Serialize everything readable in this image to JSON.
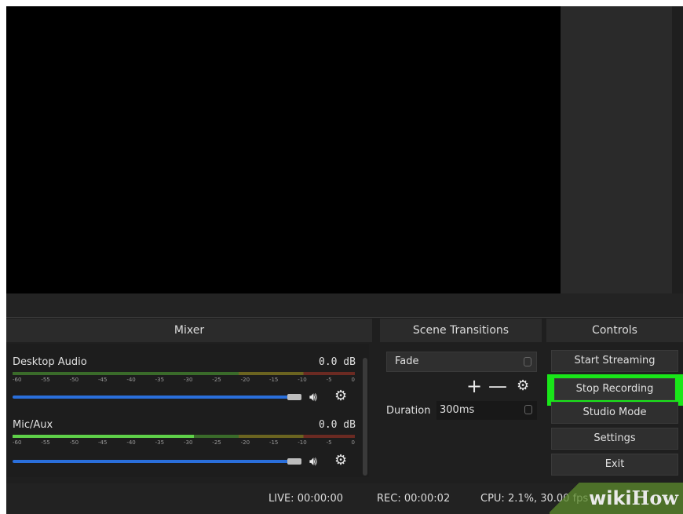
{
  "docks": {
    "mixer_title": "Mixer",
    "transitions_title": "Scene Transitions",
    "controls_title": "Controls"
  },
  "mixer": {
    "tracks": [
      {
        "name": "Desktop Audio",
        "level": "0.0 dB",
        "ticks": [
          "-60",
          "-55",
          "-50",
          "-45",
          "-40",
          "-35",
          "-30",
          "-25",
          "-20",
          "-15",
          "-10",
          "-5",
          "0"
        ],
        "meter_level": 0.0
      },
      {
        "name": "Mic/Aux",
        "level": "0.0 dB",
        "ticks": [
          "-60",
          "-55",
          "-50",
          "-45",
          "-40",
          "-35",
          "-30",
          "-25",
          "-20",
          "-15",
          "-10",
          "-5",
          "0"
        ],
        "meter_level": 0.53
      }
    ]
  },
  "transitions": {
    "selected": "Fade",
    "duration_label": "Duration",
    "duration_value": "300ms"
  },
  "controls": {
    "start_streaming": "Start Streaming",
    "stop_recording": "Stop Recording",
    "studio_mode": "Studio Mode",
    "settings": "Settings",
    "exit": "Exit"
  },
  "status": {
    "live": "LIVE: 00:00:00",
    "rec": "REC: 00:00:02",
    "cpu": "CPU: 2.1%, 30.00 fps"
  },
  "watermark": {
    "wiki": "wiki",
    "how": "How"
  },
  "colors": {
    "highlight": "#19e619",
    "meter_active": "#5fd049",
    "slider": "#2a6fdb"
  }
}
